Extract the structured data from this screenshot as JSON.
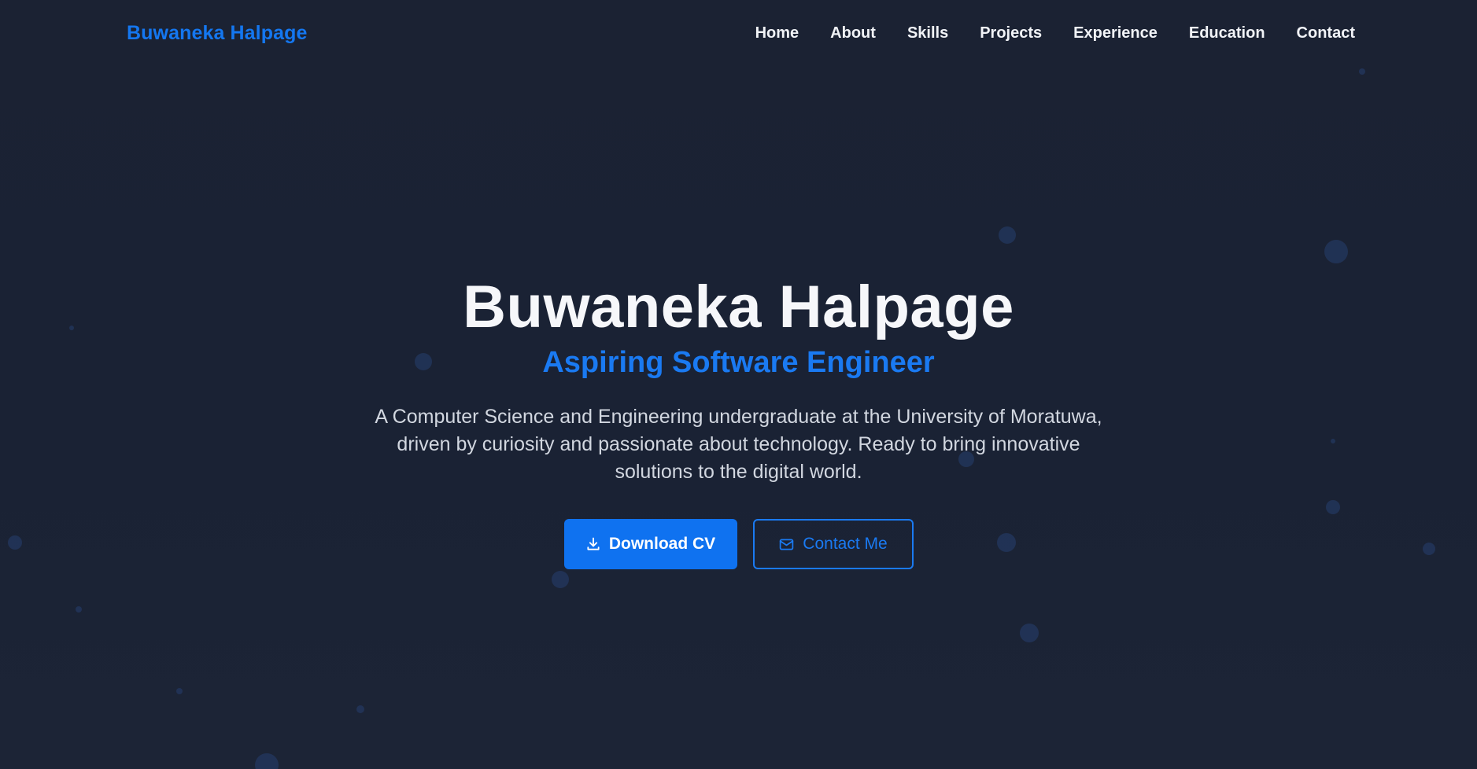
{
  "header": {
    "brand": "Buwaneka Halpage",
    "nav": [
      "Home",
      "About",
      "Skills",
      "Projects",
      "Experience",
      "Education",
      "Contact"
    ]
  },
  "hero": {
    "title": "Buwaneka Halpage",
    "subtitle": "Aspiring Software Engineer",
    "description": "A Computer Science and Engineering undergraduate at the University of Moratuwa, driven by curiosity and passionate about technology. Ready to bring innovative solutions to the digital world.",
    "primary_button": {
      "label": "Download CV",
      "icon": "download-icon"
    },
    "secondary_button": {
      "label": "Contact Me",
      "icon": "mail-icon"
    }
  },
  "colors": {
    "background": "#1a2234",
    "accent": "#1477f0",
    "text": "#f6f7fa",
    "muted_text": "#d2d7e0",
    "particle": "#22355a"
  }
}
